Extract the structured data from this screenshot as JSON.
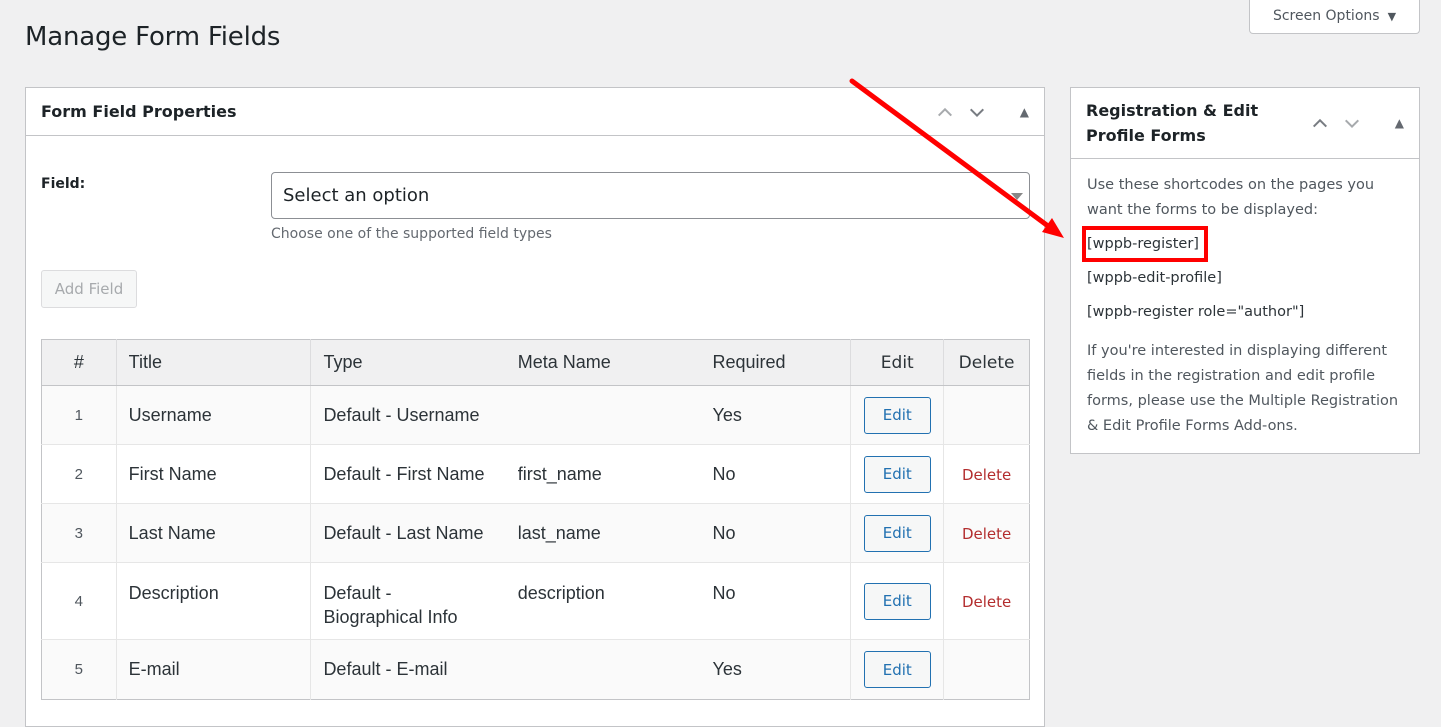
{
  "page": {
    "title": "Manage Form Fields",
    "screen_options": {
      "label": "Screen Options",
      "icon": "triangle-down-icon"
    }
  },
  "main_box": {
    "title": "Form Field Properties",
    "controls": [
      "move-up-icon",
      "move-down-icon",
      "collapse-toggle-icon"
    ],
    "field_label": "Field:",
    "select": {
      "value": "Select an option"
    },
    "select_description": "Choose one of the supported field types",
    "add_field_button": "Add Field",
    "table": {
      "headers": [
        "#",
        "Title",
        "Type",
        "Meta Name",
        "Required",
        "Edit",
        "Delete"
      ],
      "rows": [
        {
          "num": "1",
          "title": "Username",
          "type": "Default - Username",
          "meta": "",
          "required": "Yes",
          "edit": "Edit",
          "delete": ""
        },
        {
          "num": "2",
          "title": "First Name",
          "type": "Default - First Name",
          "meta": "first_name",
          "required": "No",
          "edit": "Edit",
          "delete": "Delete"
        },
        {
          "num": "3",
          "title": "Last Name",
          "type": "Default - Last Name",
          "meta": "last_name",
          "required": "No",
          "edit": "Edit",
          "delete": "Delete"
        },
        {
          "num": "4",
          "title": "Description",
          "type": "Default - Biographical Info",
          "meta": "description",
          "required": "No",
          "edit": "Edit",
          "delete": "Delete"
        },
        {
          "num": "5",
          "title": "E-mail",
          "type": "Default - E-mail",
          "meta": "",
          "required": "Yes",
          "edit": "Edit",
          "delete": ""
        }
      ]
    }
  },
  "side_box": {
    "title": "Registration & Edit Profile Forms",
    "intro": "Use these shortcodes on the pages you want the forms to be displayed:",
    "shortcodes": [
      "[wppb-register]",
      "[wppb-edit-profile]",
      "[wppb-register role=\"author\"]"
    ],
    "note": "If you're interested in displaying different fields in the registration and edit profile forms, please use the Multiple Registration & Edit Profile Forms Add-ons."
  },
  "annotation": {
    "color": "#ff0000",
    "highlighted": "[wppb-register]"
  }
}
